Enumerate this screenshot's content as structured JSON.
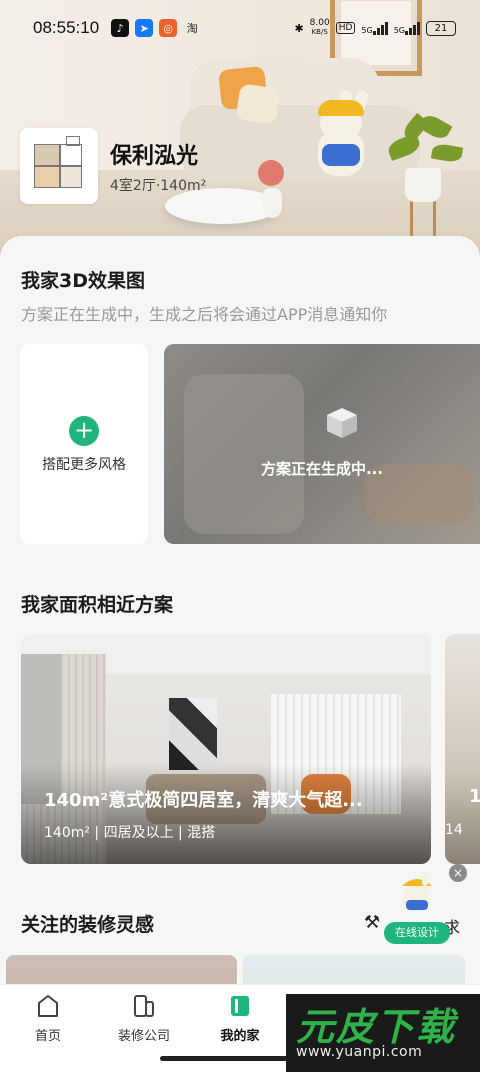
{
  "status_bar": {
    "time": "08:55:10",
    "apps": [
      {
        "name": "tiktok-icon",
        "glyph": "♪",
        "color": "#111111"
      },
      {
        "name": "arrow-app-icon",
        "glyph": "➤",
        "color": "#1677ff"
      },
      {
        "name": "red-app-icon",
        "glyph": "◎",
        "color": "#f0622d"
      },
      {
        "name": "taobao-icon",
        "glyph": "淘",
        "color": "#222222"
      }
    ],
    "speed_value": "8.00",
    "speed_unit": "KB/S",
    "hd_tag": "HD",
    "signal_a": "5G",
    "signal_b": "5G",
    "battery": "21"
  },
  "house": {
    "name": "保利泓光",
    "meta": "4室2厅·140m²"
  },
  "section_3d": {
    "title": "我家3D效果图",
    "subtitle": "方案正在生成中，生成之后将会通过APP消息通知你",
    "more_style_label": "搭配更多风格",
    "generating_label": "方案正在生成中..."
  },
  "section_similar": {
    "title": "我家面积相近方案",
    "plans": [
      {
        "title": "140m²意式极简四居室，清爽大气超...",
        "meta": "140m² | 四居及以上 | 混搭"
      },
      {
        "title": "1",
        "meta": "14"
      }
    ]
  },
  "section_follow": {
    "title": "关注的装修灵感",
    "right_suffix": "求"
  },
  "assistant": {
    "label": "在线设计",
    "close": "×"
  },
  "tabs": [
    {
      "label": "首页",
      "icon": "home-icon",
      "active": false
    },
    {
      "label": "装修公司",
      "icon": "company-icon",
      "active": false
    },
    {
      "label": "我的家",
      "icon": "my-home-icon",
      "active": true
    }
  ],
  "colors": {
    "accent": "#1fb57c",
    "background": "#f4f7f6"
  },
  "watermark": {
    "logo": "元皮下载",
    "url": "www.yuanpi.com"
  }
}
